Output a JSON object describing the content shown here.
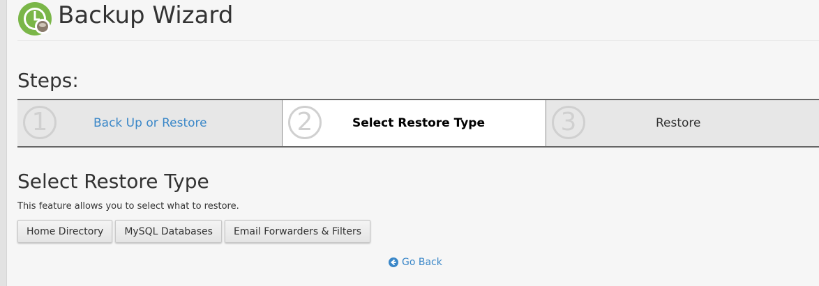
{
  "header": {
    "title": "Backup Wizard",
    "icon": "backup-wizard-icon"
  },
  "steps": {
    "heading": "Steps:",
    "items": [
      {
        "number": "1",
        "label": "Back Up or Restore",
        "state": "link"
      },
      {
        "number": "2",
        "label": "Select Restore Type",
        "state": "current"
      },
      {
        "number": "3",
        "label": "Restore",
        "state": "upcoming"
      }
    ]
  },
  "section": {
    "title": "Select Restore Type",
    "description": "This feature allows you to select what to restore."
  },
  "buttons": {
    "home_directory": "Home Directory",
    "mysql_databases": "MySQL Databases",
    "email_forwarders": "Email Forwarders & Filters"
  },
  "go_back": {
    "label": "Go Back",
    "icon": "arrow-circle-left-icon"
  },
  "colors": {
    "link": "#3a87c8",
    "icon_green": "#7ab648",
    "background": "#f6f6f6"
  }
}
